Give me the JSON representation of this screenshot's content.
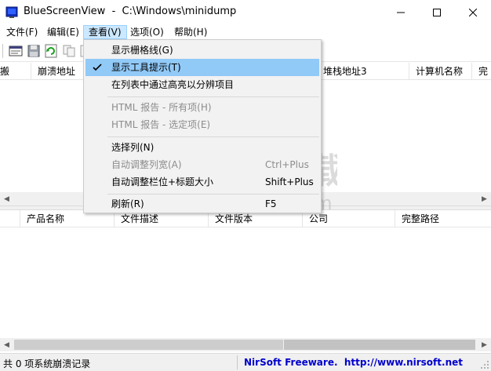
{
  "window": {
    "title": "BlueScreenView  -  C:\\Windows\\minidump",
    "app_icon": "bluescreen-app-icon",
    "controls": [
      "minimize-icon",
      "maximize-icon",
      "close-icon"
    ]
  },
  "menubar": {
    "items": [
      {
        "label": "文件(F)"
      },
      {
        "label": "编辑(E)"
      },
      {
        "label": "查看(V)",
        "active": true
      },
      {
        "label": "选项(O)"
      },
      {
        "label": "帮助(H)"
      }
    ]
  },
  "toolbar": {
    "buttons": [
      "properties-icon",
      "save-icon",
      "refresh-icon",
      "copy-icon",
      "options-icon"
    ]
  },
  "top_table": {
    "columns": [
      "搬",
      "崩溃地址",
      "堆栈地址3",
      "计算机名称",
      "完"
    ]
  },
  "bottom_table": {
    "columns": [
      "产品名称",
      "文件描述",
      "文件版本",
      "公司",
      "完整路径"
    ]
  },
  "view_menu": {
    "items": [
      {
        "label": "显示栅格线(G)",
        "shortcut": "",
        "checked": false,
        "disabled": false
      },
      {
        "label": "显示工具提示(T)",
        "shortcut": "",
        "checked": true,
        "disabled": false,
        "hover": true
      },
      {
        "label": "在列表中通过高亮以分辨项目",
        "shortcut": "",
        "checked": false,
        "disabled": false
      },
      {
        "label": "HTML 报告 - 所有项(H)",
        "shortcut": "",
        "checked": false,
        "disabled": true
      },
      {
        "label": "HTML 报告 - 选定项(E)",
        "shortcut": "",
        "checked": false,
        "disabled": true
      },
      {
        "label": "选择列(N)",
        "shortcut": "",
        "checked": false,
        "disabled": false
      },
      {
        "label": "自动调整列宽(A)",
        "shortcut": "Ctrl+Plus",
        "checked": false,
        "disabled": true
      },
      {
        "label": "自动调整栏位+标题大小",
        "shortcut": "Shift+Plus",
        "checked": false,
        "disabled": false
      },
      {
        "label": "刷新(R)",
        "shortcut": "F5",
        "checked": false,
        "disabled": false
      }
    ]
  },
  "statusbar": {
    "left": "共 0 项系统崩溃记录",
    "right": "NirSoft Freeware.  http://www.nirsoft.net"
  },
  "watermark": {
    "text": "安下载",
    "subtext": "anxz.com"
  },
  "colors": {
    "menu_active_bg": "#cce8ff",
    "menu_hover_bg": "#91c9f7",
    "status_link": "#0000cc"
  }
}
